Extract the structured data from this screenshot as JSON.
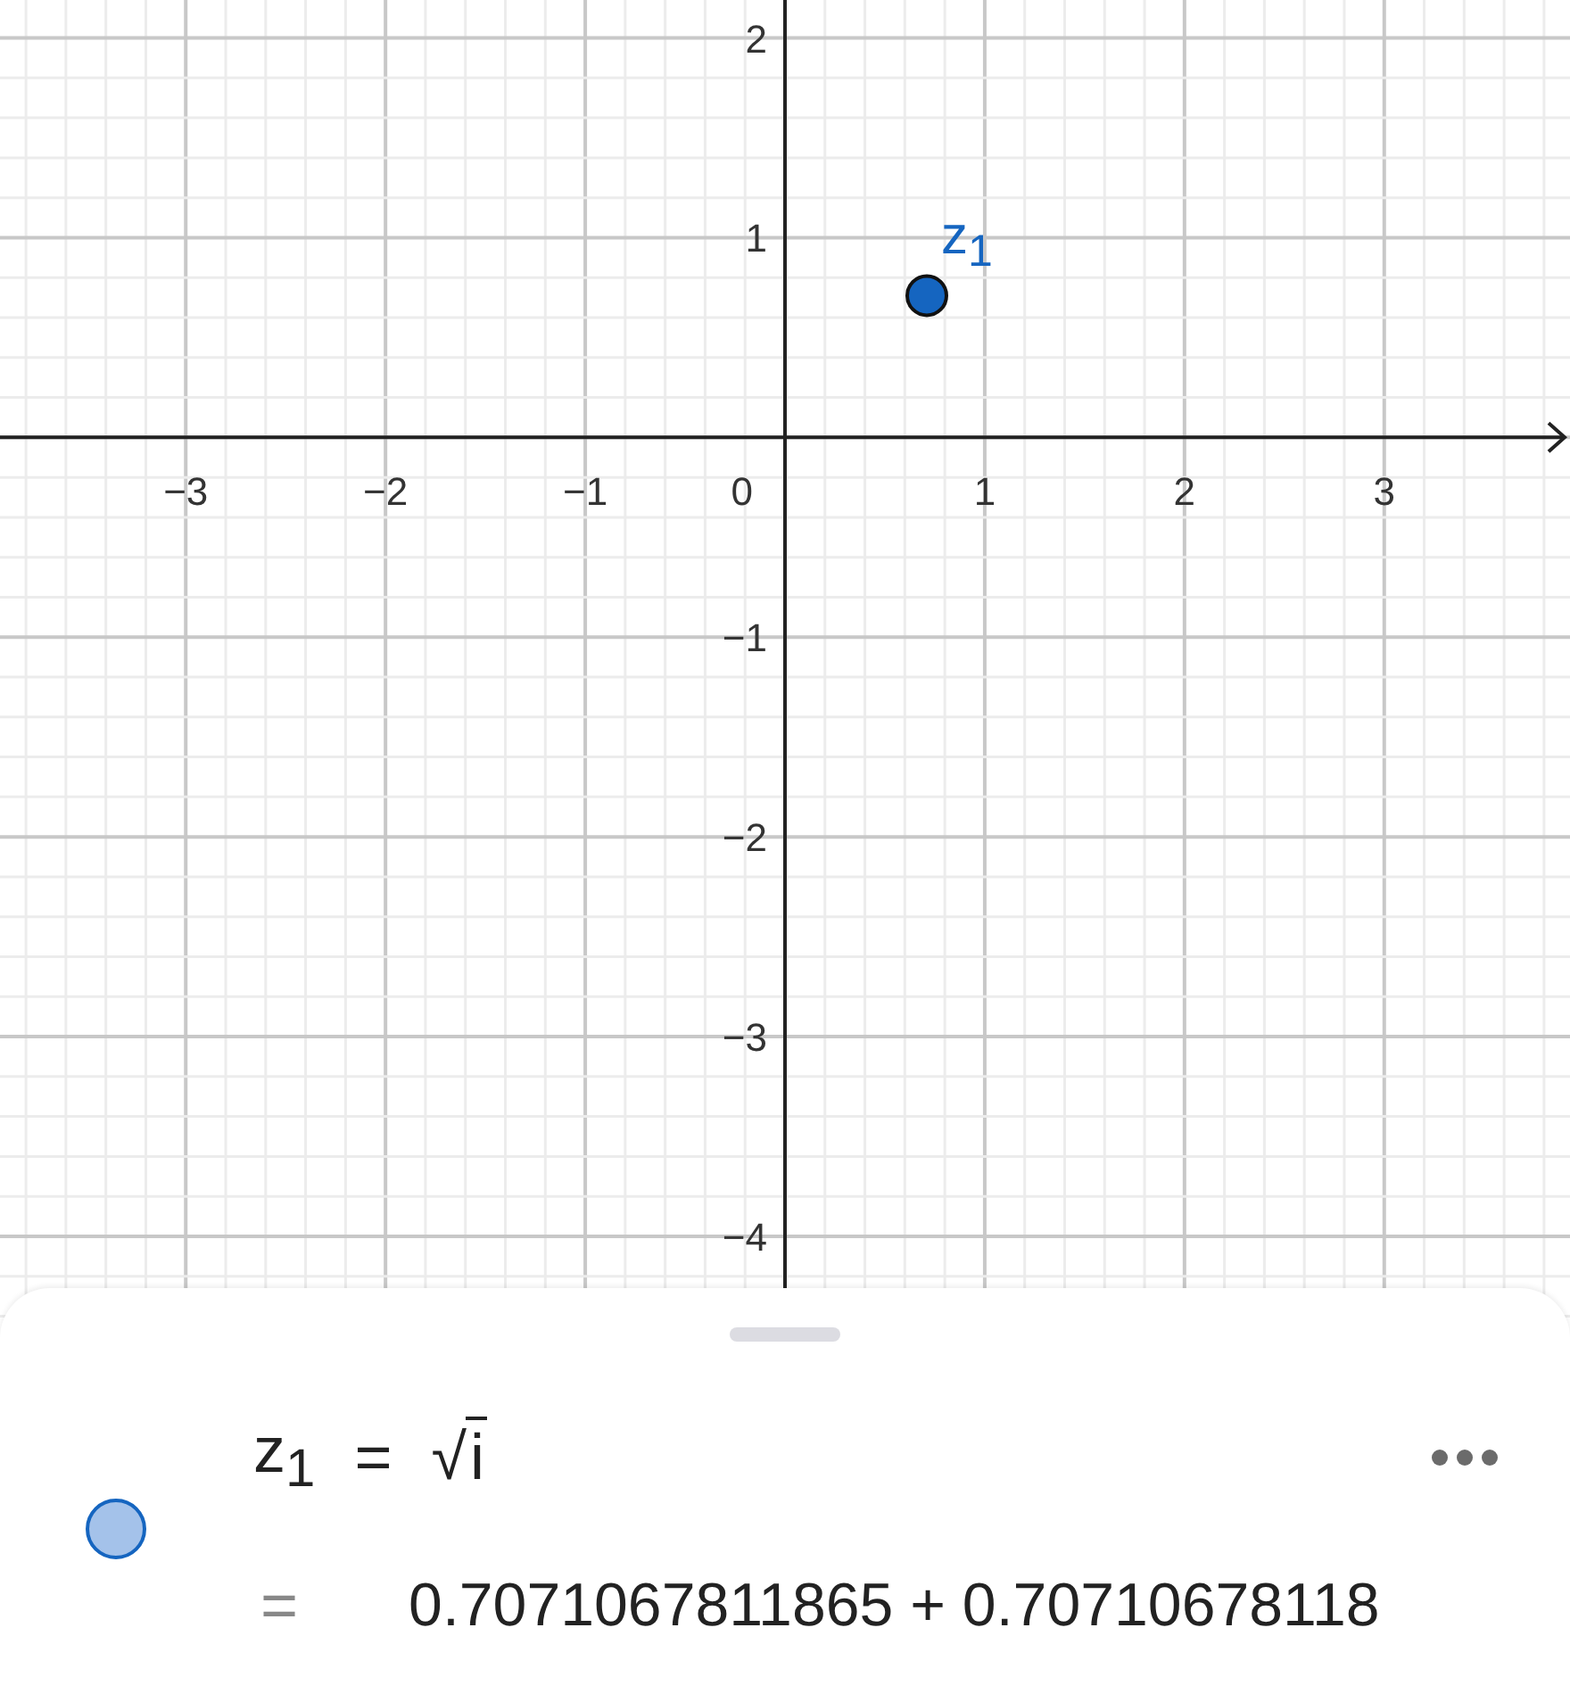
{
  "graphics_view": {
    "chart_data": {
      "type": "scatter",
      "xlim": [
        -3.93,
        3.93
      ],
      "ylim": [
        -4.42,
        2.19
      ],
      "xticks": [
        {
          "value": -3,
          "label": "−3"
        },
        {
          "value": -2,
          "label": "−2"
        },
        {
          "value": -1,
          "label": "−1"
        },
        {
          "value": 1,
          "label": "1"
        },
        {
          "value": 2,
          "label": "2"
        },
        {
          "value": 3,
          "label": "3"
        }
      ],
      "yticks": [
        {
          "value": 2,
          "label": "2"
        },
        {
          "value": 1,
          "label": "1"
        },
        {
          "value": -1,
          "label": "−1"
        },
        {
          "value": -2,
          "label": "−2"
        },
        {
          "value": -3,
          "label": "−3"
        },
        {
          "value": -4,
          "label": "−4"
        }
      ],
      "x": [
        0.71
      ],
      "grid": true,
      "series": [
        {
          "name": "z$_{1}$",
          "color": "#1565c0",
          "values": [
            0.71
          ]
        }
      ]
    },
    "origin_label": "0"
  },
  "algebra_view": {
    "items": [
      {
        "visible": true,
        "color": "#1565c0",
        "definition": {
          "lhs": "z$_{1}$",
          "operator": "=",
          "radical_sign": "√",
          "radicand": "i"
        },
        "output": {
          "operator": "=",
          "value": "0.7071067811865 + 0.70710678118"
        }
      }
    ]
  }
}
